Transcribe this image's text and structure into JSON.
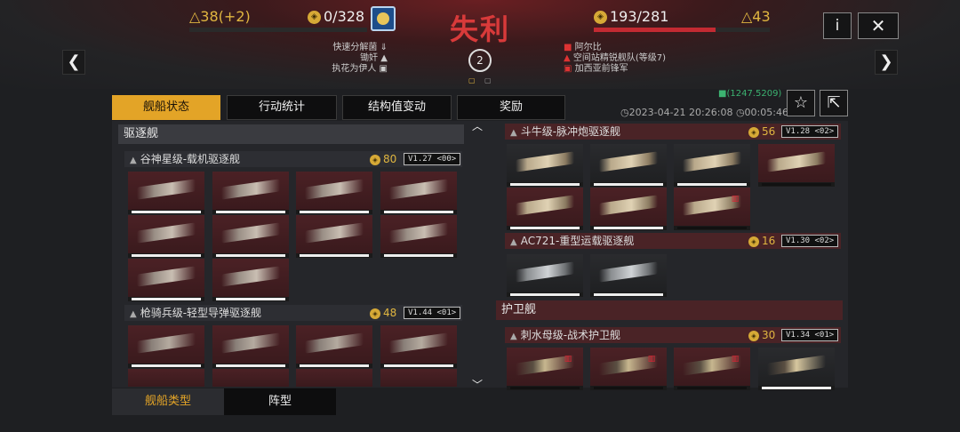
{
  "header": {
    "left_delta": "△38(+2)",
    "left_cost": "0/328",
    "title": "失利",
    "right_cost": "193/281",
    "right_delta": "△43",
    "round": "2",
    "left_players": [
      "快速分解菌",
      "锄奸",
      "执花为伊人"
    ],
    "right_players": [
      "阿尔比",
      "空间站精锐舰队(等级7)",
      "加西亚前锋军"
    ],
    "info_label": "i",
    "close_label": "✕",
    "prev_label": "❮",
    "next_label": "❯"
  },
  "tabs": [
    "舰船状态",
    "行动统计",
    "结构值变动",
    "奖励"
  ],
  "meta": {
    "power": "(1247.5209)",
    "datetime": "2023-04-21 20:26:08",
    "duration": "00:05:46"
  },
  "left_section": {
    "title": "驱逐舰",
    "groups": [
      {
        "name": "谷神星级-载机驱逐舰",
        "cost": "80",
        "version": "V1.27 <00>"
      },
      {
        "name": "枪骑兵级-轻型导弹驱逐舰",
        "cost": "48",
        "version": "V1.44 <01>"
      }
    ]
  },
  "right_section": {
    "groups": [
      {
        "name": "斗牛级-脉冲炮驱逐舰",
        "cost": "56",
        "version": "V1.28 <02>"
      },
      {
        "name": "AC721-重型运载驱逐舰",
        "cost": "16",
        "version": "V1.30 <02>"
      }
    ],
    "title2": "护卫舰",
    "groups2": [
      {
        "name": "刺水母级-战术护卫舰",
        "cost": "30",
        "version": "V1.34 <01>"
      }
    ]
  },
  "bottom_tabs": [
    "舰船类型",
    "阵型"
  ],
  "colors": {
    "accent": "#e3a427",
    "red": "#c32a32",
    "title": "#d83a3a"
  }
}
